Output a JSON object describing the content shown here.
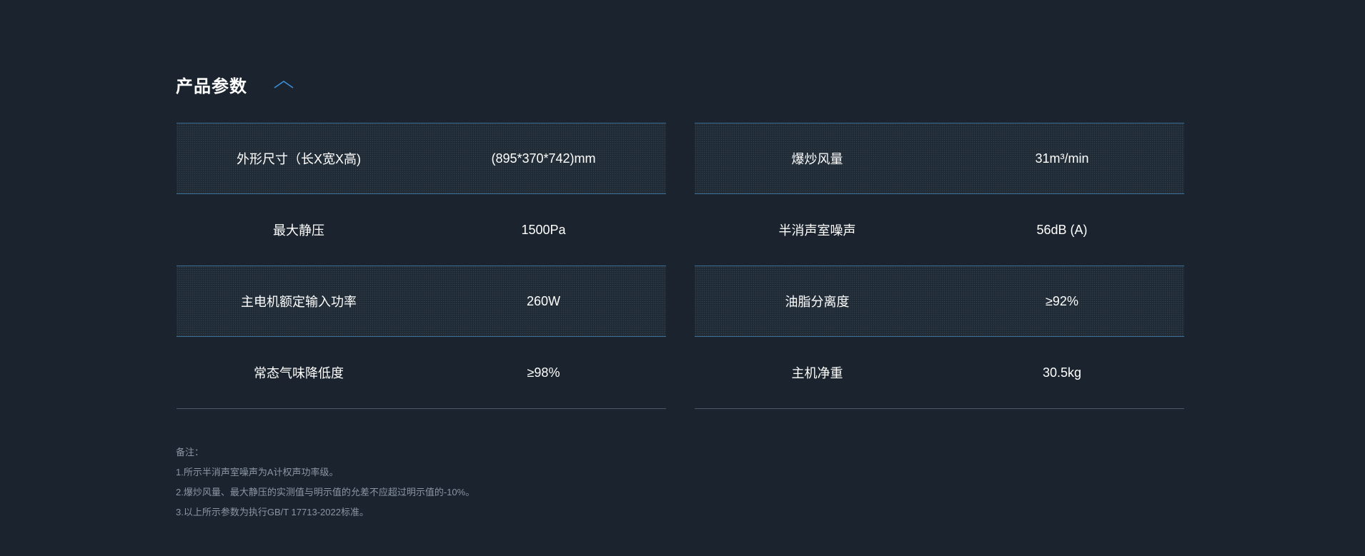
{
  "section": {
    "title": "产品参数",
    "toggle_icon": "chevron-up-icon",
    "accent_color": "#3a8fd8"
  },
  "specs_left": [
    {
      "label": "外形尺寸（长X宽X高)",
      "value": "(895*370*742)mm"
    },
    {
      "label": "最大静压",
      "value": "1500Pa"
    },
    {
      "label": "主电机额定输入功率",
      "value": "260W"
    },
    {
      "label": "常态气味降低度",
      "value": "≥98%"
    }
  ],
  "specs_right": [
    {
      "label": "爆炒风量",
      "value": "31m³/min"
    },
    {
      "label": "半消声室噪声",
      "value": "56dB (A)"
    },
    {
      "label": "油脂分离度",
      "value": "≥92%"
    },
    {
      "label": "主机净重",
      "value": "30.5kg"
    }
  ],
  "notes": {
    "heading": "备注：",
    "items": [
      "1.所示半消声室噪声为A计权声功率级。",
      "2.爆炒风量、最大静压的实测值与明示值的允差不应超过明示值的-10%。",
      "3.以上所示参数为执行GB/T 17713-2022标准。"
    ]
  }
}
